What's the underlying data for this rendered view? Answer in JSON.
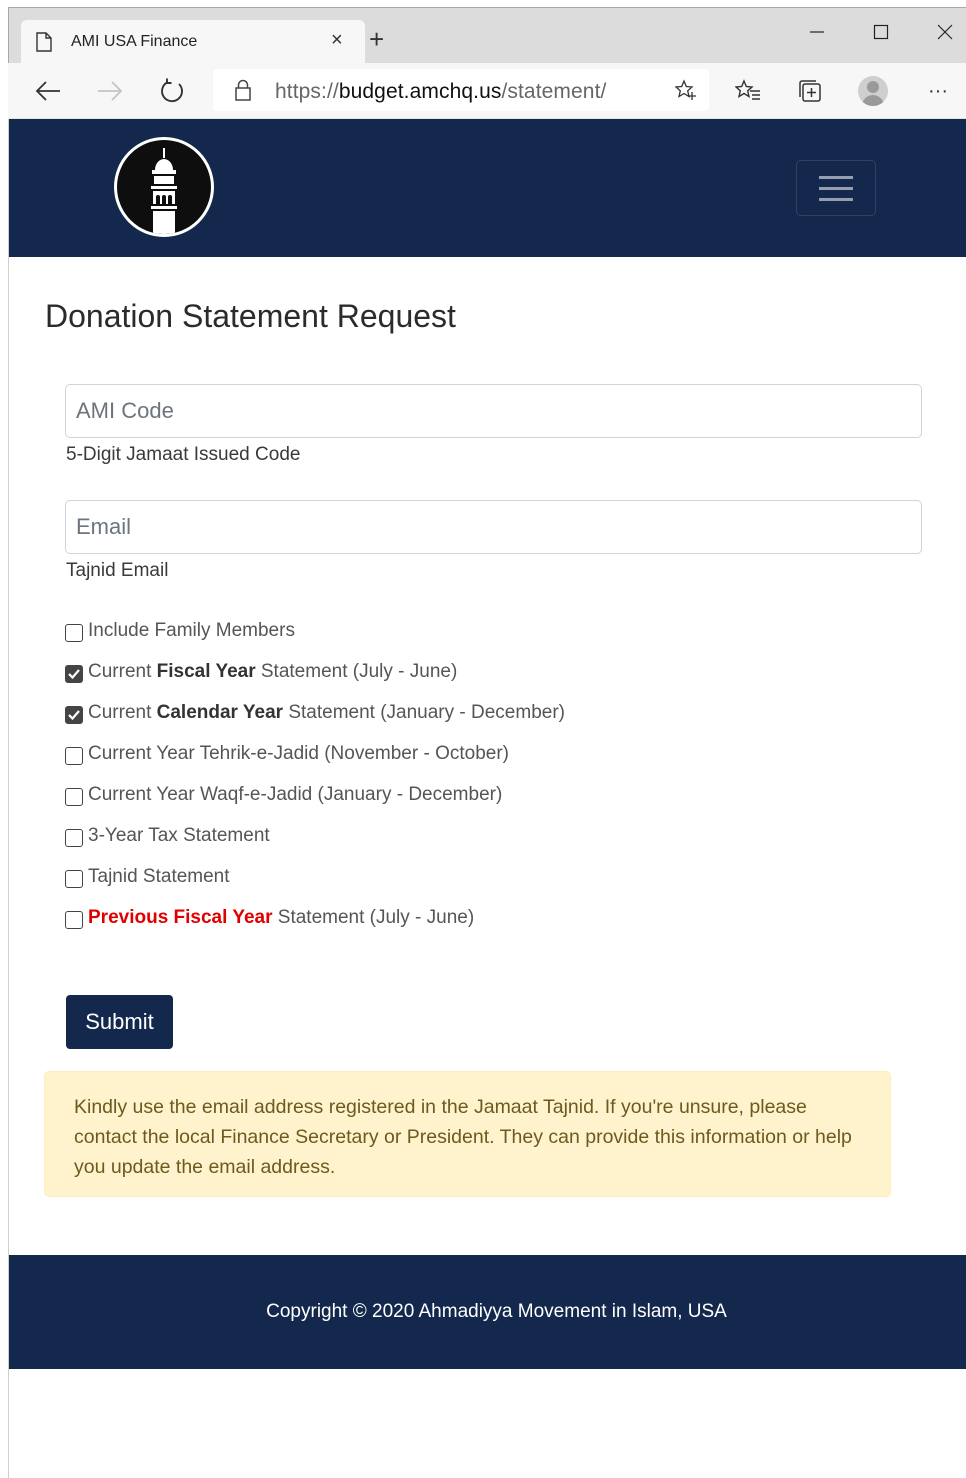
{
  "browser": {
    "tab_title": "AMI USA Finance",
    "tab_close": "×",
    "new_tab": "+",
    "url_scheme": "https://",
    "url_host": "budget.amchq.us",
    "url_path": "/statement/",
    "menu_dots": "···"
  },
  "page": {
    "title": "Donation Statement Request"
  },
  "form": {
    "ami_code": {
      "placeholder": "AMI Code",
      "value": "",
      "help": "5-Digit Jamaat Issued Code"
    },
    "email": {
      "placeholder": "Email",
      "value": "",
      "help": "Tajnid Email"
    },
    "options": [
      {
        "checked": false,
        "text": "Include Family Members"
      },
      {
        "checked": true,
        "prefix": "Current ",
        "bold": "Fiscal Year",
        "suffix": " Statement (July - June)"
      },
      {
        "checked": true,
        "prefix": "Current ",
        "bold": "Calendar Year",
        "suffix": " Statement (January - December)"
      },
      {
        "checked": false,
        "text": "Current Year Tehrik-e-Jadid (November - October)"
      },
      {
        "checked": false,
        "text": "Current Year Waqf-e-Jadid (January - December)"
      },
      {
        "checked": false,
        "text": "3-Year Tax Statement"
      },
      {
        "checked": false,
        "text": "Tajnid Statement"
      },
      {
        "checked": false,
        "highlight": "Previous Fiscal Year",
        "suffix": " Statement (July - June)",
        "highlight_color": "#e00000"
      }
    ],
    "submit_label": "Submit"
  },
  "alert": {
    "text": "Kindly use the email address registered in the Jamaat Tajnid. If you're unsure, please contact the local Finance Secretary or President. They can provide this information or help you update the email address."
  },
  "footer": {
    "text": "Copyright © 2020 Ahmadiyya Movement in Islam, USA"
  },
  "colors": {
    "brand_navy": "#13284c",
    "alert_bg": "#fff3cd",
    "alert_text": "#6d5a1f",
    "highlight_red": "#e00000"
  },
  "icons": [
    "page-icon",
    "back-arrow-icon",
    "forward-arrow-icon",
    "refresh-icon",
    "lock-icon",
    "star-add-icon",
    "favorites-icon",
    "collections-icon",
    "profile-icon",
    "more-icon",
    "minimize-icon",
    "maximize-icon",
    "close-icon",
    "mosque-minaret-logo",
    "hamburger-menu-icon",
    "checkbox-check-icon"
  ]
}
